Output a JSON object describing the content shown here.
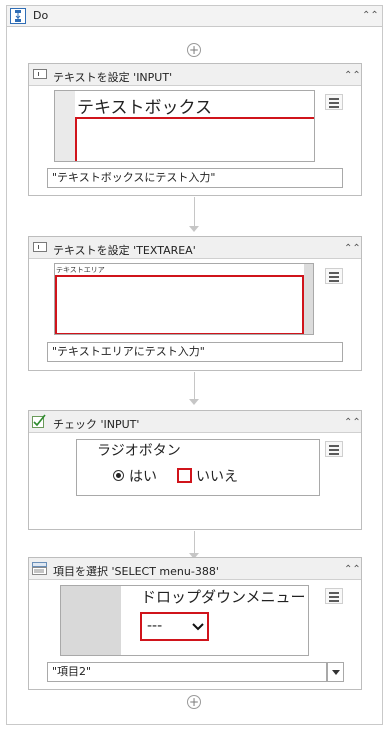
{
  "do": {
    "title": "Do"
  },
  "activities": [
    {
      "title": "テキストを設定 'INPUT'",
      "preview_text": "テキストボックス",
      "value": "\"テキストボックスにテスト入力\""
    },
    {
      "title": "テキストを設定 'TEXTAREA'",
      "preview_text": "テキストエリア",
      "value": "\"テキストエリアにテスト入力\""
    },
    {
      "title": "チェック 'INPUT'",
      "preview_title": "ラジオボタン",
      "option_yes": "はい",
      "option_no": "いいえ"
    },
    {
      "title": "項目を選択 'SELECT menu-388'",
      "preview_title": "ドロップダウンメニュー",
      "select_value": "---",
      "value": "\"項目2\""
    }
  ],
  "icons": {
    "sequence": "sequence-icon",
    "type_into": "type-into-icon",
    "check": "check-icon",
    "select_item": "select-item-icon",
    "collapse": "collapse-icon",
    "menu": "menu-icon",
    "add": "add-activity-icon",
    "dropdown": "dropdown-arrow-icon"
  },
  "colors": {
    "highlight": "#d0141b"
  }
}
